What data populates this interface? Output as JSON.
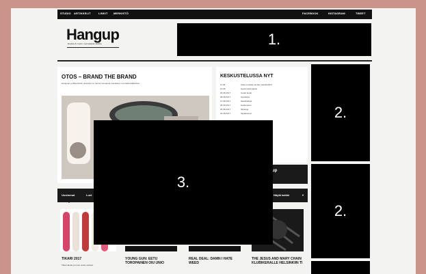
{
  "nav": {
    "left_items": [
      "STUDIO",
      "ARTIKKELIT",
      "LINKIT",
      "MERKISTÖ"
    ],
    "right_items": [
      "FACEBOOK",
      "INSTAGRAM",
      "TWEET"
    ]
  },
  "brand": {
    "logo": "Hangup",
    "tagline": "Rautaa & muoto: suomalaista skeittia."
  },
  "ads": {
    "banner_label": "1.",
    "side_top_label": "2.",
    "side_mid_label": "2.",
    "overlay_label": "3."
  },
  "feature": {
    "title": "OTOS – BRAND THE BRAND",
    "blurb": "Hangupin ja Beershirtin yhteistyö on tuonut muutamia uutuuksia. Lue lisää artikkelista."
  },
  "discussion": {
    "title": "KESKUSTELUSSA NYT",
    "rows": [
      {
        "date": "11.08",
        "text": "Kuka muistaa vanhan skeittihallin?"
      },
      {
        "date": "10.08",
        "text": "Spotti Helsingissä"
      },
      {
        "date": "29.08.2017",
        "text": "Uudet lautat"
      },
      {
        "date": "28.08.2017",
        "text": "Spottilista"
      },
      {
        "date": "27.08.2017",
        "text": "Skeittileffoja"
      },
      {
        "date": "26.08.2017",
        "text": "Keskustelut"
      },
      {
        "date": "25.08.2017",
        "text": "Muistoja"
      },
      {
        "date": "24.08.2017",
        "text": "Tapahtumat"
      }
    ]
  },
  "side_box": {
    "title": "up"
  },
  "tabs": {
    "items": [
      "Uusimmat",
      "Luet"
    ],
    "right_item": "Näytä kaikki"
  },
  "articles": [
    {
      "title": "TIKARI 2017",
      "desc": "Tiikeri-lautat ja muut uudet tuotteet."
    },
    {
      "title": "YOUNG GUN: EETU TOROPAINEN OIU UNIO",
      "desc": ""
    },
    {
      "title": "REAL DEAL: DAMN I HATE WEED",
      "desc": ""
    },
    {
      "title": "THE JESUS AND MARY CHAIN KLUBIKERALLE HELSINKIIN TI",
      "desc": ""
    }
  ],
  "colors": {
    "frame": "#c9958a",
    "page_bg": "#f3f3f1",
    "nav_bg": "#111111",
    "ad_block": "#000000",
    "tab_bg": "#1a1a1a"
  }
}
